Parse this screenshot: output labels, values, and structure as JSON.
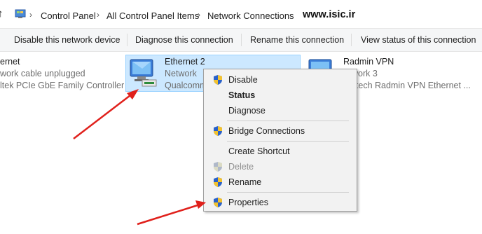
{
  "address_bar": {
    "icons": [
      "up-arrow-icon",
      "control-panel-icon",
      "chevron-right-icon"
    ],
    "breadcrumb": [
      "Control Panel",
      "All Control Panel Items",
      "Network Connections"
    ],
    "watermark": "www.isic.ir"
  },
  "toolbar": {
    "disable": "Disable this network device",
    "diagnose": "Diagnose this connection",
    "rename": "Rename this connection",
    "view_status": "View status of this connection"
  },
  "adapters": [
    {
      "name": "ernet",
      "status": "work cable unplugged",
      "device": "ltek PCIe GbE Family Controller"
    },
    {
      "name": "Ethernet 2",
      "status": "Network",
      "device": "Qualcomm",
      "selected": true
    },
    {
      "name": "Radmin VPN",
      "status": "work 3",
      "device": "natech Radmin VPN Ethernet ..."
    }
  ],
  "context_menu": {
    "items": [
      {
        "label": "Disable",
        "icon": "uac-shield-icon"
      },
      {
        "label": "Status",
        "default": true
      },
      {
        "label": "Diagnose"
      },
      {
        "label": "Bridge Connections",
        "icon": "uac-shield-icon"
      },
      {
        "label": "Create Shortcut"
      },
      {
        "label": "Delete",
        "icon": "uac-shield-icon",
        "disabled": true
      },
      {
        "label": "Rename",
        "icon": "uac-shield-icon"
      },
      {
        "label": "Properties",
        "icon": "uac-shield-icon"
      }
    ]
  },
  "annotation": {
    "arrow_color": "#e0201b"
  },
  "colors": {
    "selection": "#cce8ff",
    "selection_border": "#99d1ff",
    "menu_bg": "#f2f2f2"
  }
}
